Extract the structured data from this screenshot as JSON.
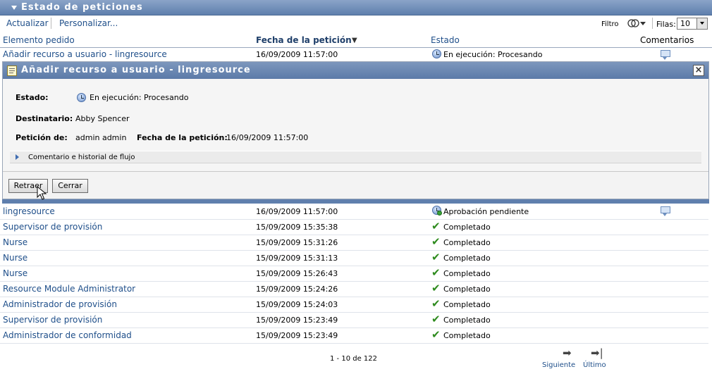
{
  "header": {
    "title": "Estado de peticiones"
  },
  "toolbar": {
    "refresh": "Actualizar",
    "customize": "Personalizar...",
    "filter": "Filtro",
    "rows_label": "Filas:",
    "rows_value": "10"
  },
  "columns": {
    "item": "Elemento pedido",
    "date": "Fecha de la petición",
    "status": "Estado",
    "comments": "Comentarios"
  },
  "selected_row": {
    "item": "Añadir recurso a usuario - lingresource",
    "date": "16/09/2009 11:57:00",
    "status": "En ejecución: Procesando"
  },
  "detail": {
    "title": "Añadir recurso a usuario - lingresource",
    "status_label": "Estado:",
    "status_value": "En ejecución: Procesando",
    "recipient_label": "Destinatario:",
    "recipient_value": "Abby Spencer",
    "requester_label": "Petición de:",
    "requester_value": "admin admin",
    "date_label": "Fecha de la petición:",
    "date_value": "16/09/2009 11:57:00",
    "history": "Comentario e historial de flujo",
    "retract_button": "Retraer",
    "close_button": "Cerrar"
  },
  "rows": [
    {
      "item": "lingresource",
      "date": "16/09/2009 11:57:00",
      "status": "Aprobación pendiente",
      "icon": "clock-pending",
      "comment": true
    },
    {
      "item": "Supervisor de provisión",
      "date": "15/09/2009 15:35:38",
      "status": "Completado",
      "icon": "check",
      "comment": false
    },
    {
      "item": "Nurse",
      "date": "15/09/2009 15:31:26",
      "status": "Completado",
      "icon": "check",
      "comment": false
    },
    {
      "item": "Nurse",
      "date": "15/09/2009 15:31:13",
      "status": "Completado",
      "icon": "check",
      "comment": false
    },
    {
      "item": "Nurse",
      "date": "15/09/2009 15:26:43",
      "status": "Completado",
      "icon": "check",
      "comment": false
    },
    {
      "item": "Resource Module Administrator",
      "date": "15/09/2009 15:24:26",
      "status": "Completado",
      "icon": "check",
      "comment": false
    },
    {
      "item": "Administrador de provisión",
      "date": "15/09/2009 15:24:03",
      "status": "Completado",
      "icon": "check",
      "comment": false
    },
    {
      "item": "Supervisor de provisión",
      "date": "15/09/2009 15:23:49",
      "status": "Completado",
      "icon": "check",
      "comment": false
    },
    {
      "item": "Administrador de conformidad",
      "date": "15/09/2009 15:23:49",
      "status": "Completado",
      "icon": "check",
      "comment": false
    }
  ],
  "pager": {
    "range": "1 - 10 de 122",
    "next": "Siguiente",
    "last": "Último"
  }
}
